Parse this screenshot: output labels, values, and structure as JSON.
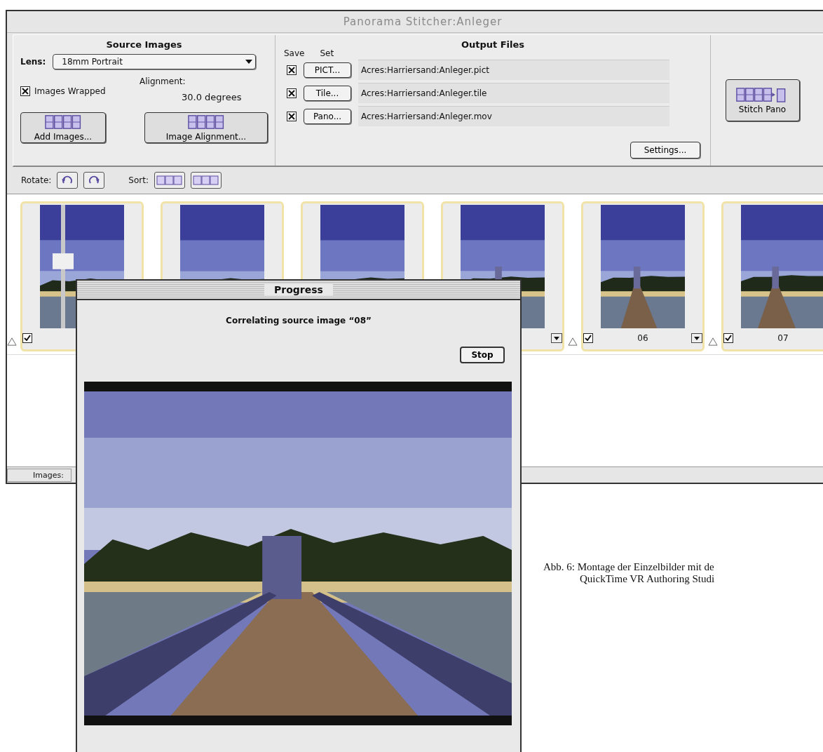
{
  "window": {
    "title": "Panorama Stitcher:Anleger"
  },
  "source_images": {
    "heading": "Source Images",
    "lens_label": "Lens:",
    "lens_value": "18mm Portrait",
    "images_wrapped": {
      "label": "Images Wrapped",
      "checked": true
    },
    "alignment_label": "Alignment:",
    "alignment_value": "30.0 degrees",
    "add_button": "Add Images...",
    "alignment_button": "Image Alignment..."
  },
  "output_files": {
    "heading": "Output Files",
    "save_label": "Save",
    "set_label": "Set",
    "rows": [
      {
        "save": true,
        "button": "PICT...",
        "path": "Acres:Harriersand:Anleger.pict"
      },
      {
        "save": true,
        "button": "Tile...",
        "path": "Acres:Harriersand:Anleger.tile"
      },
      {
        "save": true,
        "button": "Pano...",
        "path": "Acres:Harriersand:Anleger.mov"
      }
    ],
    "settings_button": "Settings..."
  },
  "stitch_button": "Stitch Pano",
  "toolbar": {
    "rotate_label": "Rotate:",
    "sort_label": "Sort:"
  },
  "strip": [
    {
      "kind": "marker"
    },
    {
      "kind": "thumbnail",
      "footer": [
        {
          "kind": "checkbox",
          "checked": true
        }
      ]
    },
    {
      "kind": "thumbnail"
    },
    {
      "kind": "thumbnail"
    },
    {
      "kind": "thumbnail",
      "footer": [
        {
          "kind": "dropdown"
        }
      ]
    },
    {
      "kind": "marker"
    },
    {
      "kind": "thumbnail",
      "footer": [
        {
          "kind": "checkbox",
          "checked": true
        },
        {
          "kind": "label",
          "text": "06"
        },
        {
          "kind": "dropdown"
        }
      ]
    },
    {
      "kind": "marker"
    },
    {
      "kind": "thumbnail",
      "footer": [
        {
          "kind": "checkbox",
          "checked": true
        },
        {
          "kind": "label",
          "text": "07"
        }
      ]
    }
  ],
  "status_bar": {
    "label": "Images:"
  },
  "progress": {
    "title": "Progress",
    "message": "Correlating source image “08”",
    "stop_button": "Stop"
  },
  "caption": [
    "Abb. 6: Montage der Einzelbilder mit de",
    "QuickTime VR Authoring Studi"
  ]
}
